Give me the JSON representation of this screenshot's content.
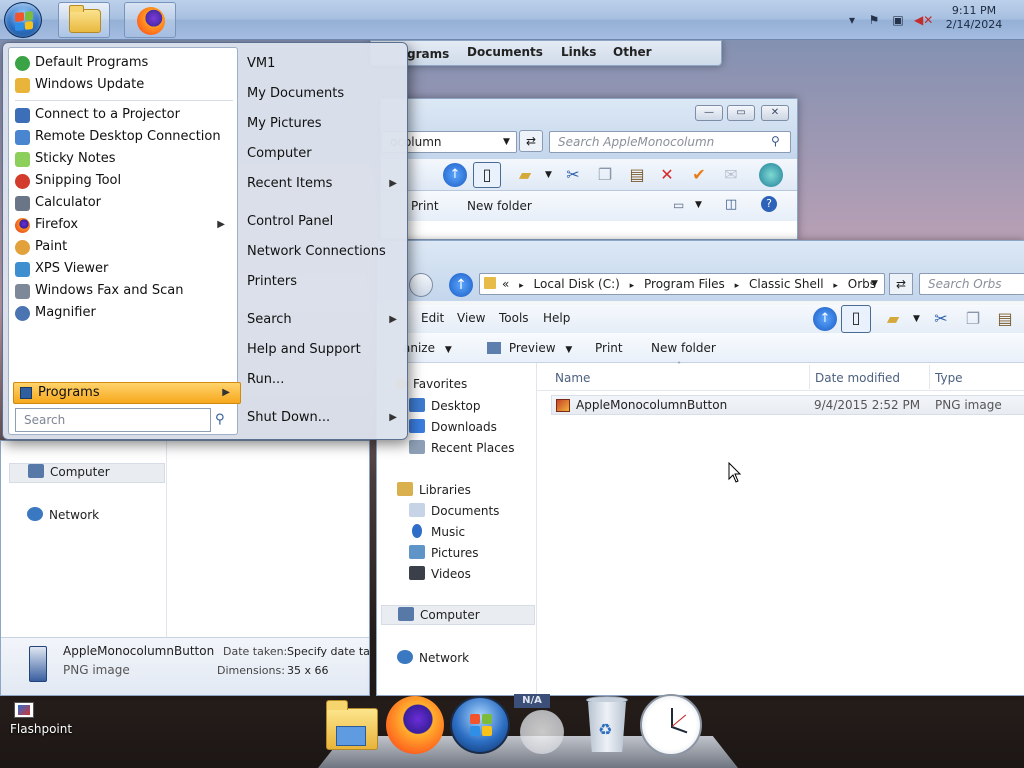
{
  "taskbar": {
    "clock_time": "9:11 PM",
    "clock_date": "2/14/2024",
    "tray_icons": [
      "chevron-up-icon",
      "action-center-flag-icon",
      "network-icon",
      "volume-muted-icon"
    ]
  },
  "bg_window": {
    "tabs": [
      "grams",
      "Documents",
      "Links",
      "Other"
    ]
  },
  "window1": {
    "address": "ocolumn",
    "search_placeholder": "Search AppleMonocolumn",
    "commands": [
      "Print",
      "New folder"
    ]
  },
  "window2": {
    "breadcrumb": [
      "«",
      "Local Disk (C:)",
      "Program Files",
      "Classic Shell",
      "Orbs"
    ],
    "search_placeholder": "Search Orbs",
    "menu": [
      "Edit",
      "View",
      "Tools",
      "Help"
    ],
    "commands": [
      "anize",
      "Preview",
      "Print",
      "New folder"
    ],
    "nav": {
      "favorites_header": "Favorites",
      "favorites": [
        "Desktop",
        "Downloads",
        "Recent Places"
      ],
      "libraries_header": "Libraries",
      "libraries": [
        "Documents",
        "Music",
        "Pictures",
        "Videos"
      ],
      "computer": "Computer",
      "network": "Network"
    },
    "columns": [
      "Name",
      "Date modified",
      "Type"
    ],
    "files": [
      {
        "name": "AppleMonocolumnButton",
        "date": "9/4/2015 2:52 PM",
        "type": "PNG image"
      }
    ]
  },
  "window3": {
    "nav_computer": "Computer",
    "nav_network": "Network",
    "details": {
      "name": "AppleMonocolumnButton",
      "kind": "PNG image",
      "date_label": "Date taken:",
      "date_value": "Specify date tak",
      "dim_label": "Dimensions:",
      "dim_value": "35 x 66"
    }
  },
  "start_menu": {
    "left_items": [
      {
        "label": "Default Programs",
        "icon": "default-programs-icon",
        "color": "#3aa345"
      },
      {
        "label": "Windows Update",
        "icon": "windows-update-icon",
        "color": "#e8b43a"
      },
      {
        "label": "Connect to a Projector",
        "icon": "projector-icon",
        "color": "#3d6fb8"
      },
      {
        "label": "Remote Desktop Connection",
        "icon": "remote-desktop-icon",
        "color": "#4a86cf"
      },
      {
        "label": "Sticky Notes",
        "icon": "sticky-notes-icon",
        "color": "#8ccf5a"
      },
      {
        "label": "Snipping Tool",
        "icon": "snipping-tool-icon",
        "color": "#d33c2c"
      },
      {
        "label": "Calculator",
        "icon": "calculator-icon",
        "color": "#6a7688"
      },
      {
        "label": "Firefox",
        "icon": "firefox-icon",
        "color": "#ff6a1f"
      },
      {
        "label": "Paint",
        "icon": "paint-icon",
        "color": "#e2a13b"
      },
      {
        "label": "XPS Viewer",
        "icon": "xps-viewer-icon",
        "color": "#3e8fd0"
      },
      {
        "label": "Windows Fax and Scan",
        "icon": "fax-scan-icon",
        "color": "#7d8899"
      },
      {
        "label": "Magnifier",
        "icon": "magnifier-icon",
        "color": "#4b74b3"
      }
    ],
    "programs_label": "Programs",
    "search_placeholder": "Search",
    "right_items": [
      {
        "label": "VM1",
        "arrow": false
      },
      {
        "label": "My Documents",
        "arrow": false
      },
      {
        "label": "My Pictures",
        "arrow": false
      },
      {
        "label": "Computer",
        "arrow": false
      },
      {
        "label": "Recent Items",
        "arrow": true
      },
      {
        "label": "Control Panel",
        "arrow": false
      },
      {
        "label": "Network Connections",
        "arrow": false
      },
      {
        "label": "Printers",
        "arrow": false
      },
      {
        "label": "Search",
        "arrow": true
      },
      {
        "label": "Help and Support",
        "arrow": false
      },
      {
        "label": "Run...",
        "arrow": false
      },
      {
        "label": "Shut Down...",
        "arrow": true
      }
    ]
  },
  "desktop": {
    "shortcut_label": "Flashpoint"
  },
  "dock": {
    "items": [
      "file-explorer-icon",
      "firefox-icon",
      "start-orb-icon",
      "na-gadget-icon",
      "recycle-bin-icon",
      "clock-icon"
    ],
    "gadget_text": "N/A"
  }
}
